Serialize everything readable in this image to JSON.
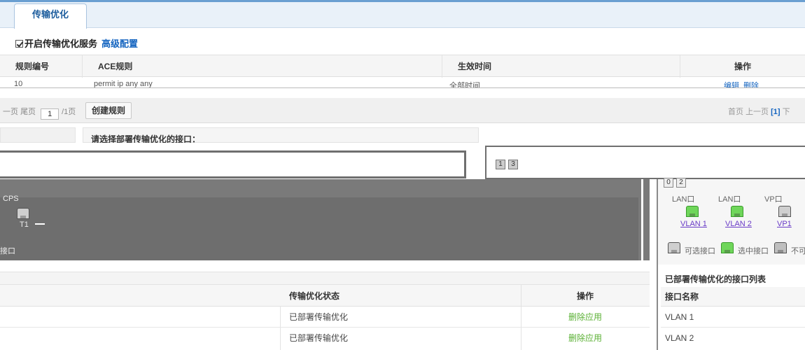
{
  "tabs": {
    "active": "传输优化"
  },
  "enable": {
    "label": "开启传输优化服务",
    "advanced_link": "高级配置"
  },
  "rule_table": {
    "headers": [
      "规则编号",
      "ACE规则",
      "生效时间",
      "操作"
    ],
    "row": {
      "id": "10",
      "ace": "permit ip any any",
      "time": "全部时间",
      "edit": "编辑",
      "delete": "删除"
    }
  },
  "pager": {
    "prev": "一页",
    "last": "尾页",
    "page_value": "1",
    "total": "/1页",
    "create_button": "创建规则",
    "first": "首页",
    "prev_page": "上一页",
    "current": "[1]",
    "next": "下"
  },
  "deploy": {
    "prompt": "请选择部署传输优化的接口：",
    "left_ports": [
      {
        "label": "CPS"
      },
      {
        "label": "T1"
      }
    ],
    "left_legend": "接口",
    "right_groups": [
      "LAN口",
      "LAN口",
      "VP口"
    ],
    "right_ports": [
      {
        "label": "VLAN 1"
      },
      {
        "label": "VLAN 2"
      },
      {
        "label": "VP1"
      }
    ],
    "right_legend": [
      "可选接口",
      "选中接口",
      "不可选"
    ],
    "numbers": [
      "1",
      "3",
      "0",
      "2"
    ]
  },
  "status_table": {
    "headers": [
      "传输优化状态",
      "操作"
    ],
    "rows": [
      {
        "status": "已部署传输优化",
        "action": "删除应用"
      },
      {
        "status": "已部署传输优化",
        "action": "删除应用"
      }
    ]
  },
  "deployed_list": {
    "title": "已部署传输优化的接口列表",
    "header": "接口名称",
    "rows": [
      "VLAN 1",
      "VLAN 2"
    ]
  },
  "colors": {
    "accent": "#1565c0",
    "action_green": "#5bb135",
    "port_green": "#6fd65a",
    "link_purple": "#6a3cc7"
  }
}
